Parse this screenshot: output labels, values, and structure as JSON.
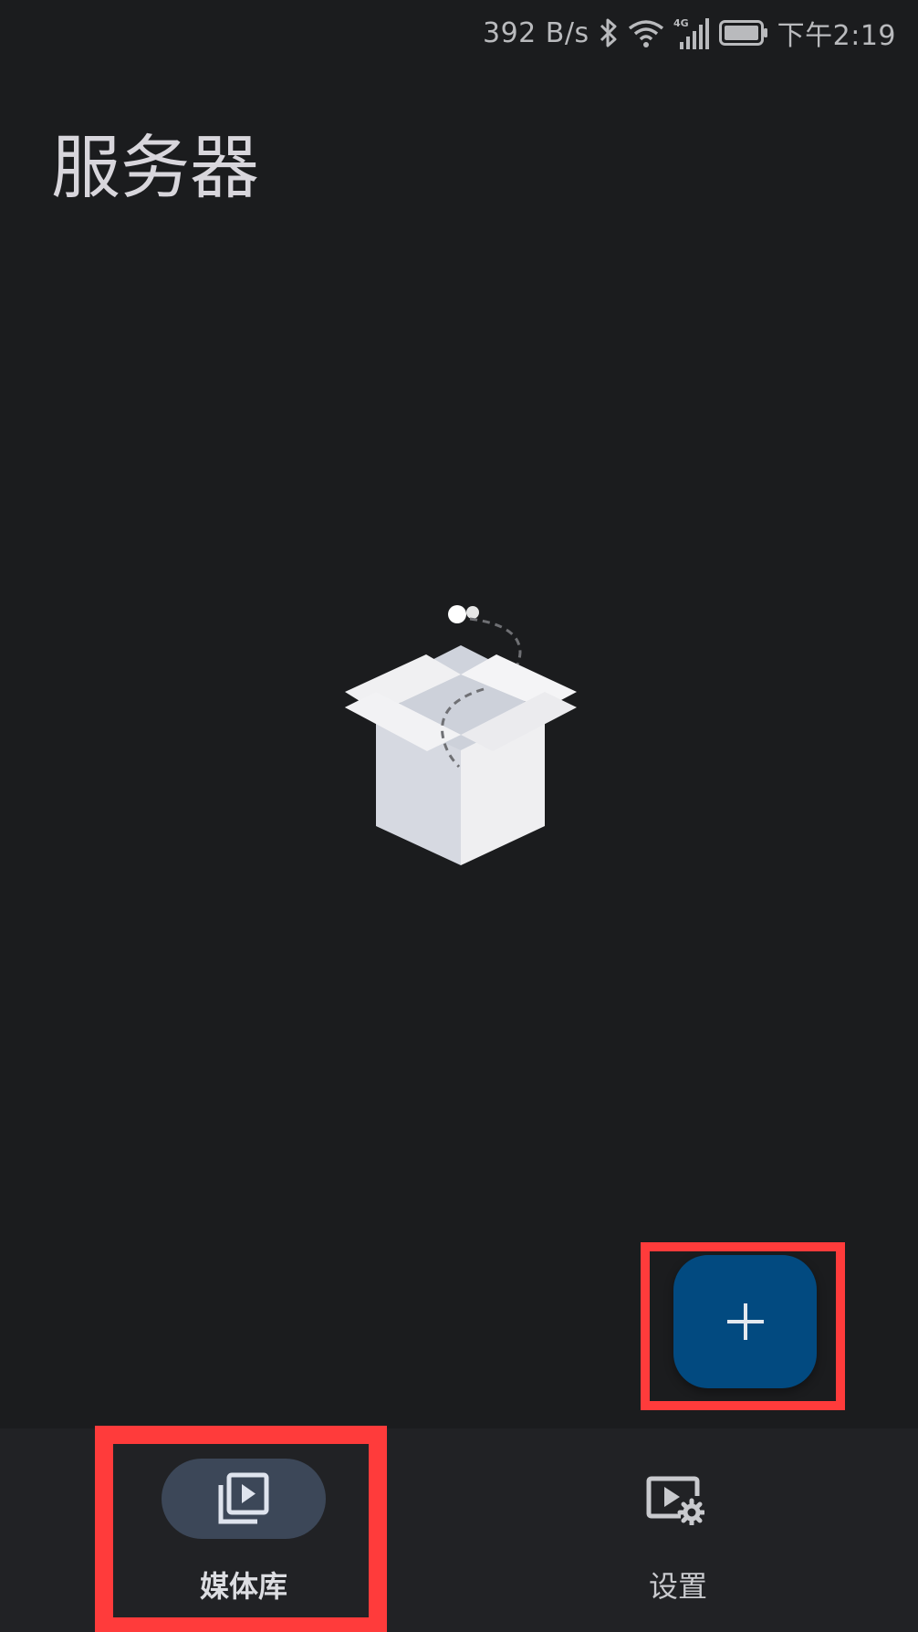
{
  "status_bar": {
    "net_speed": "392 B/s",
    "network_type": "4G",
    "time": "下午2:19",
    "icons": [
      "bluetooth-icon",
      "wifi-icon",
      "signal-icon",
      "battery-icon"
    ]
  },
  "header": {
    "title": "服务器"
  },
  "empty_state": {
    "illustration": "open-box-icon"
  },
  "fab": {
    "icon": "plus-icon",
    "color": "#024a80"
  },
  "bottom_nav": {
    "items": [
      {
        "label": "媒体库",
        "icon": "video-library-icon",
        "selected": true
      },
      {
        "label": "设置",
        "icon": "video-settings-icon",
        "selected": false
      }
    ],
    "indicator_color": "#3c4758"
  },
  "colors": {
    "background": "#1b1c1e",
    "nav_background": "#212225",
    "highlight": "#ff3b3b"
  }
}
